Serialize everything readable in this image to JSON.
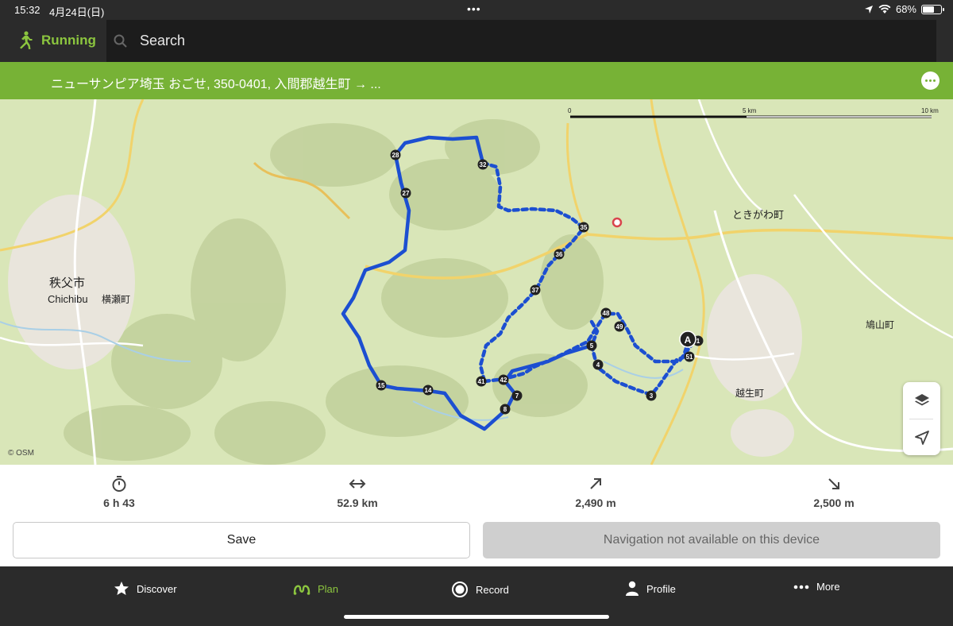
{
  "status": {
    "time": "15:32",
    "date": "4月24日(日)",
    "battery": "68%",
    "battery_level": 0.68
  },
  "header": {
    "sport_label": "Running",
    "sport_icon": "runner-icon",
    "search_placeholder": "Search"
  },
  "location_banner": {
    "text": "ニューサンピア埼玉 おごせ, 350-0401, 入間郡越生町 → ..."
  },
  "map": {
    "attribution": "© OSM",
    "scale": {
      "zero": "0",
      "mid": "5 km",
      "max": "10 km"
    },
    "place_labels": [
      "秩父市",
      "Chichibu",
      "横瀬町",
      "ときがわ町",
      "鳩山町",
      "越生町"
    ],
    "start_marker": "A",
    "waypoints": [
      "1",
      "3",
      "4",
      "5",
      "7",
      "8",
      "14",
      "15",
      "27",
      "28",
      "32",
      "35",
      "36",
      "37",
      "41",
      "42",
      "48",
      "49",
      "51"
    ],
    "route_color": "#1c4fd1",
    "accent_color": "#77b236"
  },
  "stats": [
    {
      "icon": "stopwatch-icon",
      "value": "6 h 43"
    },
    {
      "icon": "distance-arrows-icon",
      "value": "52.9 km"
    },
    {
      "icon": "ascent-arrow-icon",
      "value": "2,490 m"
    },
    {
      "icon": "descent-arrow-icon",
      "value": "2,500 m"
    }
  ],
  "actions": {
    "save": "Save",
    "navigation": "Navigation not available on this device"
  },
  "tabs": [
    {
      "label": "Discover",
      "icon": "star-icon"
    },
    {
      "label": "Plan",
      "icon": "route-icon",
      "active": true
    },
    {
      "label": "Record",
      "icon": "record-icon"
    },
    {
      "label": "Profile",
      "icon": "person-icon"
    },
    {
      "label": "More",
      "icon": "ellipsis-icon"
    }
  ]
}
